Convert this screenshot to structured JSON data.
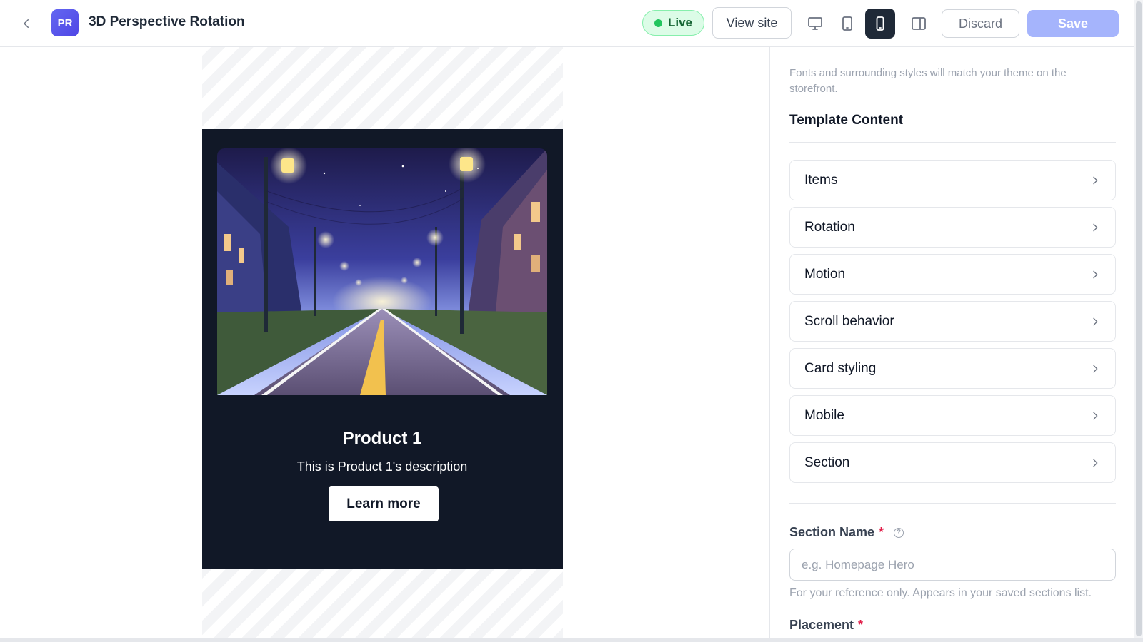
{
  "header": {
    "back_icon": "chevron-left-icon",
    "avatar_initials": "PR",
    "title": "3D Perspective Rotation",
    "live_label": "Live",
    "view_site_label": "View site",
    "devices": [
      "desktop-icon",
      "tablet-icon",
      "mobile-icon",
      "sidebar-panel-icon"
    ],
    "active_device": "mobile",
    "discard_label": "Discard",
    "save_label": "Save"
  },
  "preview": {
    "card": {
      "title": "Product 1",
      "description": "This is Product 1's description",
      "button_label": "Learn more"
    }
  },
  "panel": {
    "note": "Fonts and surrounding styles will match your theme on the storefront.",
    "heading": "Template Content",
    "items": [
      {
        "label": "Items"
      },
      {
        "label": "Rotation"
      },
      {
        "label": "Motion"
      },
      {
        "label": "Scroll behavior"
      },
      {
        "label": "Card styling"
      },
      {
        "label": "Mobile"
      },
      {
        "label": "Section"
      }
    ],
    "section_name": {
      "label": "Section Name",
      "required_mark": "*",
      "placeholder": "e.g. Homepage Hero",
      "help": "For your reference only. Appears in your saved sections list."
    },
    "placement": {
      "label": "Placement",
      "required_mark": "*"
    }
  },
  "colors": {
    "accent": "#6366f1",
    "save_disabled": "#a5b4fc",
    "live_green": "#22c55e",
    "dark_section": "#111827"
  }
}
